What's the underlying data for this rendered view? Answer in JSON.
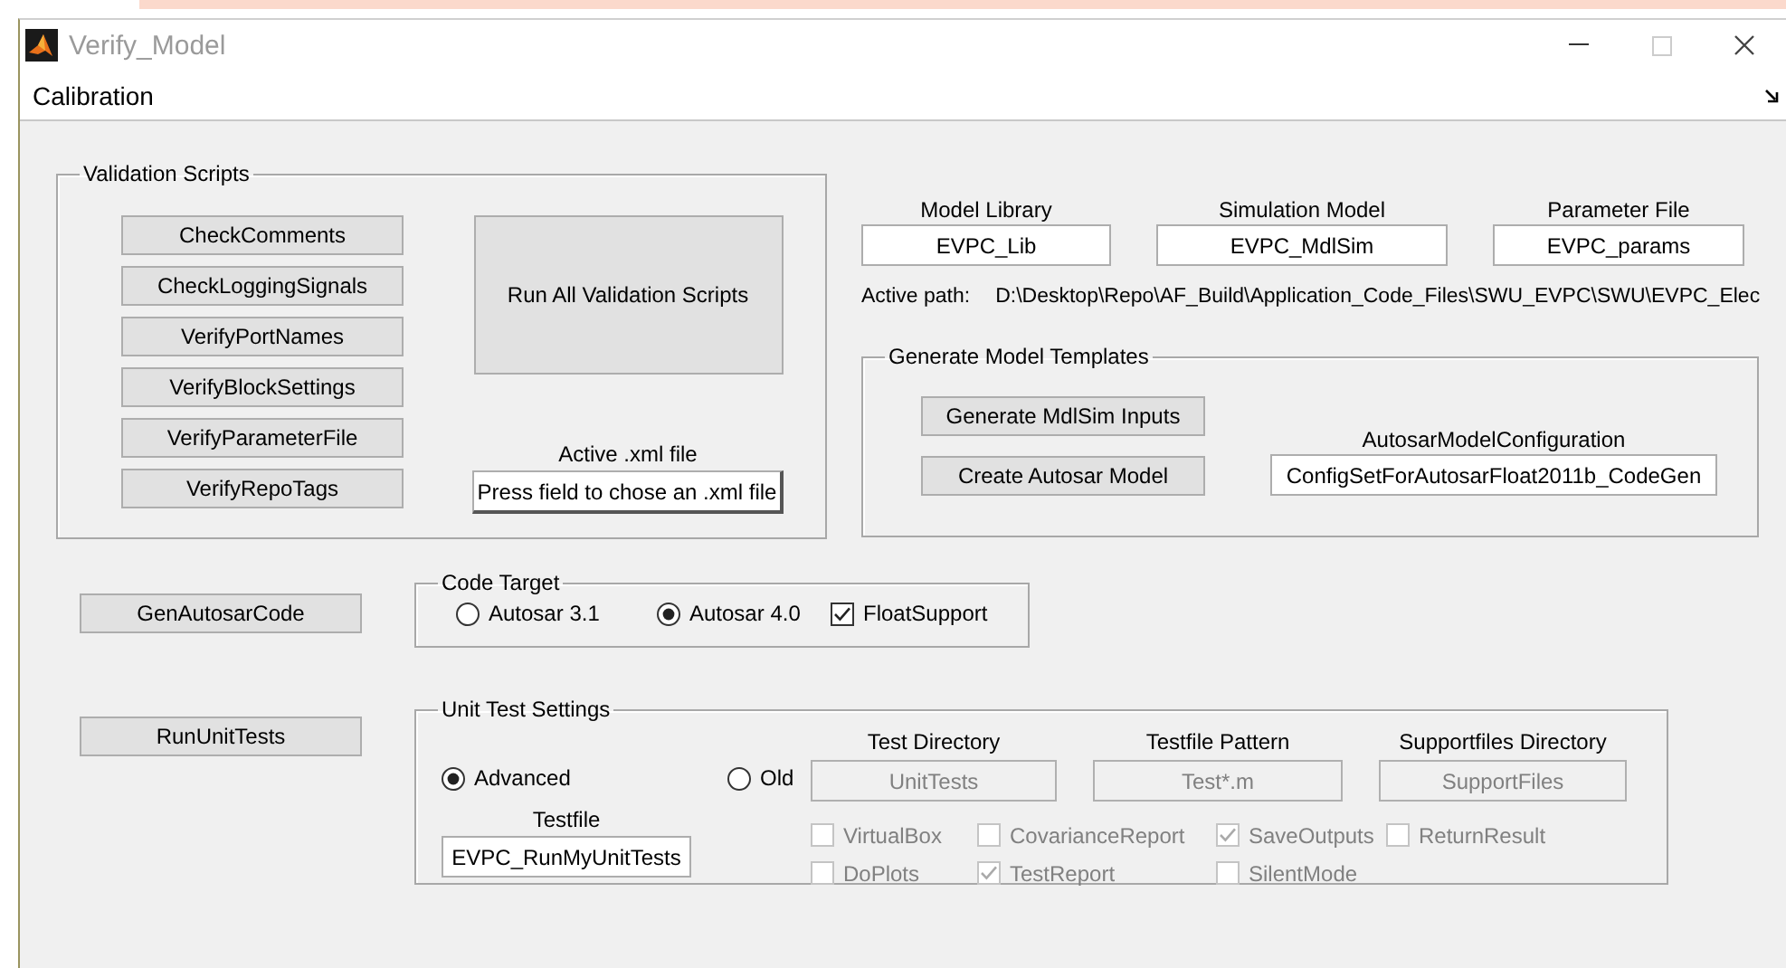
{
  "window": {
    "title": "Verify_Model"
  },
  "menu": [
    {
      "label": "Calibration"
    }
  ],
  "validation_scripts": {
    "title": "Validation Scripts",
    "buttons": [
      "CheckComments",
      "CheckLoggingSignals",
      "VerifyPortNames",
      "VerifyBlockSettings",
      "VerifyParameterFile",
      "VerifyRepoTags"
    ],
    "run_all": "Run All Validation Scripts",
    "xml_label": "Active .xml file",
    "xml_field": "Press field to chose an .xml file"
  },
  "model_files": [
    {
      "label": "Model Library",
      "value": "EVPC_Lib"
    },
    {
      "label": "Simulation Model",
      "value": "EVPC_MdlSim"
    },
    {
      "label": "Parameter File",
      "value": "EVPC_params"
    }
  ],
  "active_path": {
    "label": "Active path:",
    "value": "D:\\Desktop\\Repo\\AF_Build\\Application_Code_Files\\SWU_EVPC\\SWU\\EVPC_Elec"
  },
  "templates": {
    "title": "Generate Model Templates",
    "buttons": [
      "Generate MdlSim Inputs",
      "Create Autosar Model"
    ],
    "config_label": "AutosarModelConfiguration",
    "config_value": "ConfigSetForAutosarFloat2011b_CodeGen"
  },
  "gen_code_button": "GenAutosarCode",
  "code_target": {
    "title": "Code Target",
    "options": [
      {
        "label": "Autosar 3.1",
        "selected": false
      },
      {
        "label": "Autosar 4.0",
        "selected": true
      }
    ],
    "float_support": {
      "label": "FloatSupport",
      "checked": true
    }
  },
  "run_tests_button": "RunUnitTests",
  "unit_tests": {
    "title": "Unit Test Settings",
    "modes": [
      {
        "label": "Advanced",
        "selected": true
      },
      {
        "label": "Old",
        "selected": false
      }
    ],
    "testfile": {
      "label": "Testfile",
      "value": "EVPC_RunMyUnitTests"
    },
    "directories": [
      {
        "label": "Test Directory",
        "value": "UnitTests",
        "disabled": true
      },
      {
        "label": "Testfile Pattern",
        "value": "Test*.m",
        "disabled": true
      },
      {
        "label": "Supportfiles Directory",
        "value": "SupportFiles",
        "disabled": true
      }
    ],
    "options": [
      {
        "label": "VirtualBox",
        "checked": false,
        "disabled": true
      },
      {
        "label": "CovarianceReport",
        "checked": false,
        "disabled": true
      },
      {
        "label": "SaveOutputs",
        "checked": true,
        "disabled": true
      },
      {
        "label": "ReturnResult",
        "checked": false,
        "disabled": true
      },
      {
        "label": "DoPlots",
        "checked": false,
        "disabled": true
      },
      {
        "label": "TestReport",
        "checked": true,
        "disabled": true
      },
      {
        "label": "SilentMode",
        "checked": false,
        "disabled": true
      }
    ]
  }
}
